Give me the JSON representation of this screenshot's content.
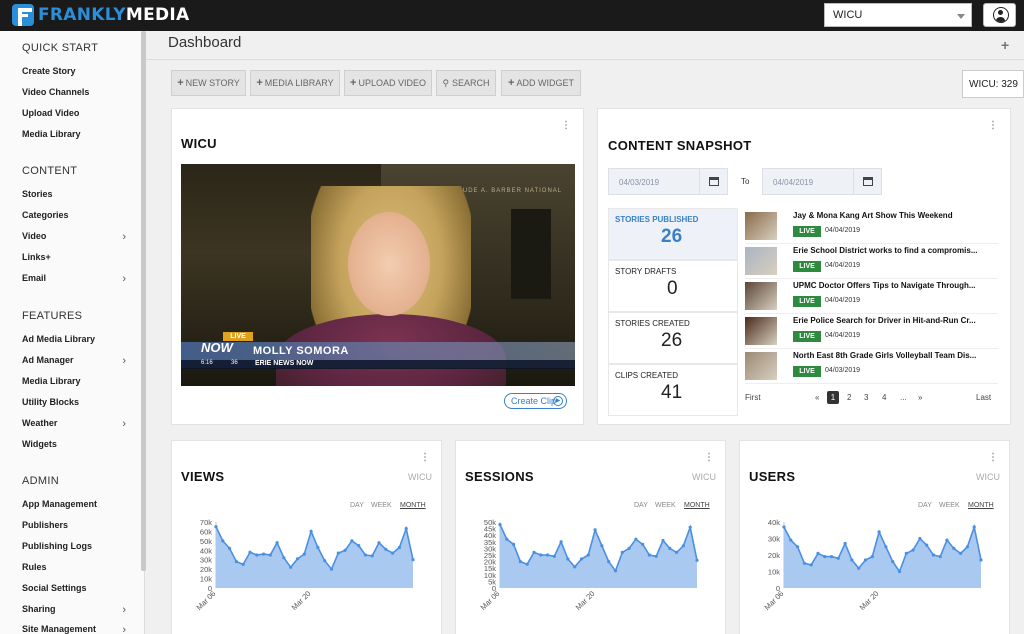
{
  "header": {
    "brand_a": "FRANKLY",
    "brand_b": "MEDIA",
    "site_select": "WICU",
    "page_title": "Dashboard",
    "add_symbol": "+"
  },
  "sidebar": {
    "sections": [
      {
        "title": "QUICK START",
        "items": [
          {
            "label": "Create Story",
            "chevron": false
          },
          {
            "label": "Video Channels",
            "chevron": false
          },
          {
            "label": "Upload Video",
            "chevron": false
          },
          {
            "label": "Media Library",
            "chevron": false
          }
        ]
      },
      {
        "title": "CONTENT",
        "items": [
          {
            "label": "Stories",
            "chevron": false
          },
          {
            "label": "Categories",
            "chevron": false
          },
          {
            "label": "Video",
            "chevron": true
          },
          {
            "label": "Links+",
            "chevron": false
          },
          {
            "label": "Email",
            "chevron": true
          }
        ]
      },
      {
        "title": "FEATURES",
        "items": [
          {
            "label": "Ad Media Library",
            "chevron": false
          },
          {
            "label": "Ad Manager",
            "chevron": true
          },
          {
            "label": "Media Library",
            "chevron": false
          },
          {
            "label": "Utility Blocks",
            "chevron": false
          },
          {
            "label": "Weather",
            "chevron": true
          },
          {
            "label": "Widgets",
            "chevron": false
          }
        ]
      },
      {
        "title": "ADMIN",
        "items": [
          {
            "label": "App Management",
            "chevron": false
          },
          {
            "label": "Publishers",
            "chevron": false
          },
          {
            "label": "Publishing Logs",
            "chevron": false
          },
          {
            "label": "Rules",
            "chevron": false
          },
          {
            "label": "Social Settings",
            "chevron": false
          },
          {
            "label": "Sharing",
            "chevron": true
          },
          {
            "label": "Site Management",
            "chevron": true
          }
        ]
      }
    ]
  },
  "toolbar": {
    "new_story": "NEW STORY",
    "media_library": "MEDIA LIBRARY",
    "upload_video": "UPLOAD VIDEO",
    "search": "SEARCH",
    "add_widget": "ADD WIDGET",
    "wicu_count": "WICU: 329"
  },
  "video_card": {
    "title": "WICU",
    "create_clip": "Create Clip",
    "overlay": {
      "live": "LIVE",
      "logo": "NOW",
      "name": "MOLLY SOMORA",
      "subtitle": "ERIE NEWS NOW",
      "time": "6:16",
      "temp": "36"
    },
    "building_sign": "DR. GERTRUDE A. BARBER NATIONAL INSTITUTE"
  },
  "snapshot": {
    "title": "CONTENT SNAPSHOT",
    "date_from": "04/03/2019",
    "to_label": "To",
    "date_to": "04/04/2019",
    "stats": [
      {
        "label": "STORIES PUBLISHED",
        "value": "26",
        "highlight": true
      },
      {
        "label": "STORY DRAFTS",
        "value": "0",
        "highlight": false
      },
      {
        "label": "STORIES CREATED",
        "value": "26",
        "highlight": false
      },
      {
        "label": "CLIPS CREATED",
        "value": "41",
        "highlight": false
      }
    ],
    "stories": [
      {
        "title": "Jay & Mona Kang Art Show This Weekend",
        "status": "LIVE",
        "date": "04/04/2019",
        "thumb_color": "#8a6a4a"
      },
      {
        "title": "Erie School District works to find a compromis...",
        "status": "LIVE",
        "date": "04/04/2019",
        "thumb_color": "#a9b4c2"
      },
      {
        "title": "UPMC Doctor Offers Tips to Navigate Through...",
        "status": "LIVE",
        "date": "04/04/2019",
        "thumb_color": "#5a4638"
      },
      {
        "title": "Erie Police Search for Driver in Hit-and-Run Cr...",
        "status": "LIVE",
        "date": "04/04/2019",
        "thumb_color": "#4a2a1a"
      },
      {
        "title": "North East 8th Grade Girls Volleyball Team Dis...",
        "status": "LIVE",
        "date": "04/03/2019",
        "thumb_color": "#9a8a74"
      }
    ],
    "pager": {
      "first": "First",
      "prev": "«",
      "pages": [
        "1",
        "2",
        "3",
        "4"
      ],
      "ellipsis": "...",
      "next": "»",
      "last": "Last",
      "active": "1"
    }
  },
  "analytics": [
    {
      "title": "VIEWS",
      "site": "WICU"
    },
    {
      "title": "SESSIONS",
      "site": "WICU"
    },
    {
      "title": "USERS",
      "site": "WICU"
    }
  ],
  "range_labels": {
    "day": "DAY",
    "week": "WEEK",
    "month": "MONTH",
    "active": "month"
  },
  "chart_data": [
    {
      "type": "area",
      "x": [
        "Mar 06",
        "Mar 07",
        "Mar 08",
        "Mar 09",
        "Mar 10",
        "Mar 11",
        "Mar 12",
        "Mar 13",
        "Mar 14",
        "Mar 15",
        "Mar 16",
        "Mar 17",
        "Mar 18",
        "Mar 19",
        "Mar 20",
        "Mar 21",
        "Mar 22",
        "Mar 23",
        "Mar 24",
        "Mar 25",
        "Mar 26",
        "Mar 27",
        "Mar 28",
        "Mar 29",
        "Mar 30",
        "Mar 31",
        "Apr 01",
        "Apr 02",
        "Apr 03",
        "Apr 04"
      ],
      "x_tick_labels": [
        "Mar 06",
        "Mar 20"
      ],
      "values": [
        65000,
        50000,
        42000,
        28000,
        25000,
        38000,
        35000,
        36000,
        35000,
        48000,
        32000,
        22000,
        31000,
        36000,
        60000,
        43000,
        29000,
        20000,
        37000,
        40000,
        50000,
        45000,
        35000,
        34000,
        48000,
        41000,
        37000,
        43000,
        63000,
        30000
      ],
      "y_ticks": [
        "0",
        "10k",
        "20k",
        "30k",
        "40k",
        "50k",
        "60k",
        "70k"
      ],
      "ylim": [
        0,
        70000
      ],
      "color": "#4a90e2",
      "fill": "#aac9f0"
    },
    {
      "type": "area",
      "x": [
        "Mar 06",
        "Mar 07",
        "Mar 08",
        "Mar 09",
        "Mar 10",
        "Mar 11",
        "Mar 12",
        "Mar 13",
        "Mar 14",
        "Mar 15",
        "Mar 16",
        "Mar 17",
        "Mar 18",
        "Mar 19",
        "Mar 20",
        "Mar 21",
        "Mar 22",
        "Mar 23",
        "Mar 24",
        "Mar 25",
        "Mar 26",
        "Mar 27",
        "Mar 28",
        "Mar 29",
        "Mar 30",
        "Mar 31",
        "Apr 01",
        "Apr 02",
        "Apr 03",
        "Apr 04"
      ],
      "x_tick_labels": [
        "Mar 06",
        "Mar 20"
      ],
      "values": [
        48000,
        37000,
        33000,
        20000,
        18000,
        27000,
        25000,
        25000,
        24000,
        35000,
        22000,
        16000,
        22000,
        25000,
        44000,
        32000,
        20000,
        13000,
        27000,
        30000,
        37000,
        33000,
        25000,
        24000,
        36000,
        30000,
        27000,
        32000,
        46000,
        21000
      ],
      "y_ticks": [
        "0",
        "5k",
        "10k",
        "15k",
        "20k",
        "25k",
        "30k",
        "35k",
        "40k",
        "45k",
        "50k"
      ],
      "ylim": [
        0,
        50000
      ],
      "color": "#4a90e2",
      "fill": "#aac9f0"
    },
    {
      "type": "area",
      "x": [
        "Mar 06",
        "Mar 07",
        "Mar 08",
        "Mar 09",
        "Mar 10",
        "Mar 11",
        "Mar 12",
        "Mar 13",
        "Mar 14",
        "Mar 15",
        "Mar 16",
        "Mar 17",
        "Mar 18",
        "Mar 19",
        "Mar 20",
        "Mar 21",
        "Mar 22",
        "Mar 23",
        "Mar 24",
        "Mar 25",
        "Mar 26",
        "Mar 27",
        "Mar 28",
        "Mar 29",
        "Mar 30",
        "Mar 31",
        "Apr 01",
        "Apr 02",
        "Apr 03",
        "Apr 04"
      ],
      "x_tick_labels": [
        "Mar 06",
        "Mar 20"
      ],
      "values": [
        37000,
        29000,
        25000,
        15000,
        14000,
        21000,
        19000,
        19000,
        18000,
        27000,
        17000,
        12000,
        17000,
        19000,
        34000,
        25000,
        16000,
        10000,
        21000,
        23000,
        30000,
        26000,
        20000,
        19000,
        29000,
        24000,
        21000,
        25000,
        37000,
        17000
      ],
      "y_ticks": [
        "0",
        "10k",
        "20k",
        "30k",
        "40k"
      ],
      "ylim": [
        0,
        40000
      ],
      "color": "#4a90e2",
      "fill": "#aac9f0"
    }
  ]
}
